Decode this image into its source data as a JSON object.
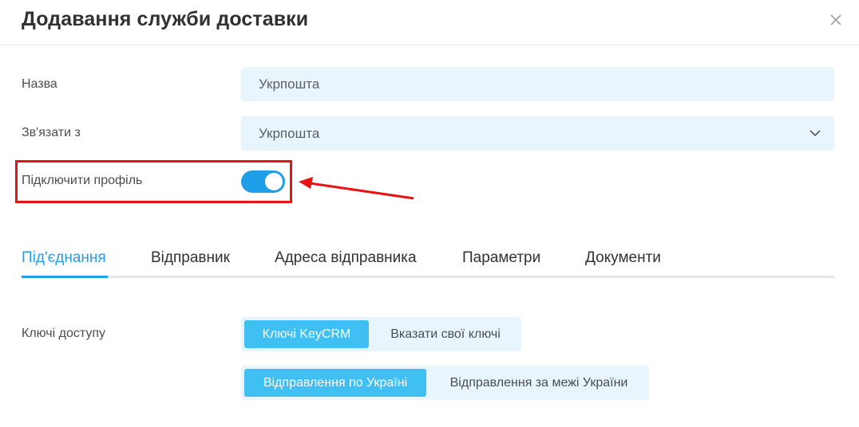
{
  "dialog": {
    "title": "Додавання служби доставки",
    "close_icon": "close-icon"
  },
  "form": {
    "name_label": "Назва",
    "name_value": "Укрпошта",
    "link_label": "Зв'язати з",
    "link_value": "Укрпошта",
    "profile_label": "Підключити профіль",
    "profile_enabled": true
  },
  "tabs": [
    {
      "label": "Під'єднання",
      "active": true
    },
    {
      "label": "Відправник",
      "active": false
    },
    {
      "label": "Адреса відправника",
      "active": false
    },
    {
      "label": "Параметри",
      "active": false
    },
    {
      "label": "Документи",
      "active": false
    }
  ],
  "access": {
    "label": "Ключі доступу",
    "keys_options": [
      "Ключі KeyCRM",
      "Вказати свої ключі"
    ],
    "keys_selected": "Ключі KeyCRM",
    "shipping_options": [
      "Відправлення по Україні",
      "Відправлення за межі України"
    ],
    "shipping_selected": "Відправлення по Україні"
  },
  "colors": {
    "accent": "#1e9fe8",
    "segment_active": "#40bff3",
    "field_bg": "#e8f5fd",
    "highlight": "#e81313"
  }
}
